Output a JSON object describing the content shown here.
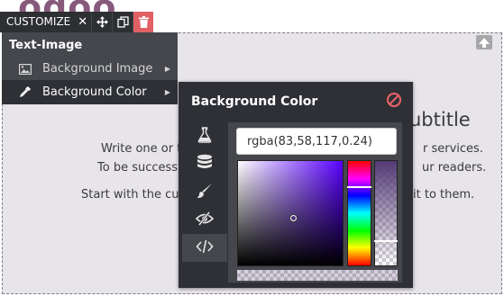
{
  "page": {
    "logo_text": "odoo",
    "heading_tail": "ubtitle",
    "lines": [
      {
        "left": "Write one or t",
        "right": "r services."
      },
      {
        "left": "To be success",
        "right": "ur readers."
      },
      {
        "left": "Start with the cus",
        "right": "it to them."
      }
    ]
  },
  "toolbar": {
    "customize_label": "CUSTOMIZE",
    "close_glyph": "✕",
    "tools": [
      {
        "name": "move-icon"
      },
      {
        "name": "clone-icon"
      },
      {
        "name": "delete-icon"
      }
    ]
  },
  "customize_menu": {
    "header": "Text-Image",
    "items": [
      {
        "label": "Background Image",
        "icon": "image-icon",
        "active": false
      },
      {
        "label": "Background Color",
        "icon": "eyedropper-icon",
        "active": true
      }
    ]
  },
  "color_panel": {
    "title": "Background Color",
    "reset_icon": "ban-icon",
    "tabs": [
      {
        "icon": "flask-icon",
        "active": false
      },
      {
        "icon": "database-icon",
        "active": false
      },
      {
        "icon": "paint-brush-icon",
        "active": false
      },
      {
        "icon": "eye-slash-icon",
        "active": false
      },
      {
        "icon": "code-icon",
        "active": true
      }
    ],
    "value": "rgba(83,58,117,0.24)",
    "selected_color": "#533a75",
    "alpha": 0.24
  }
}
